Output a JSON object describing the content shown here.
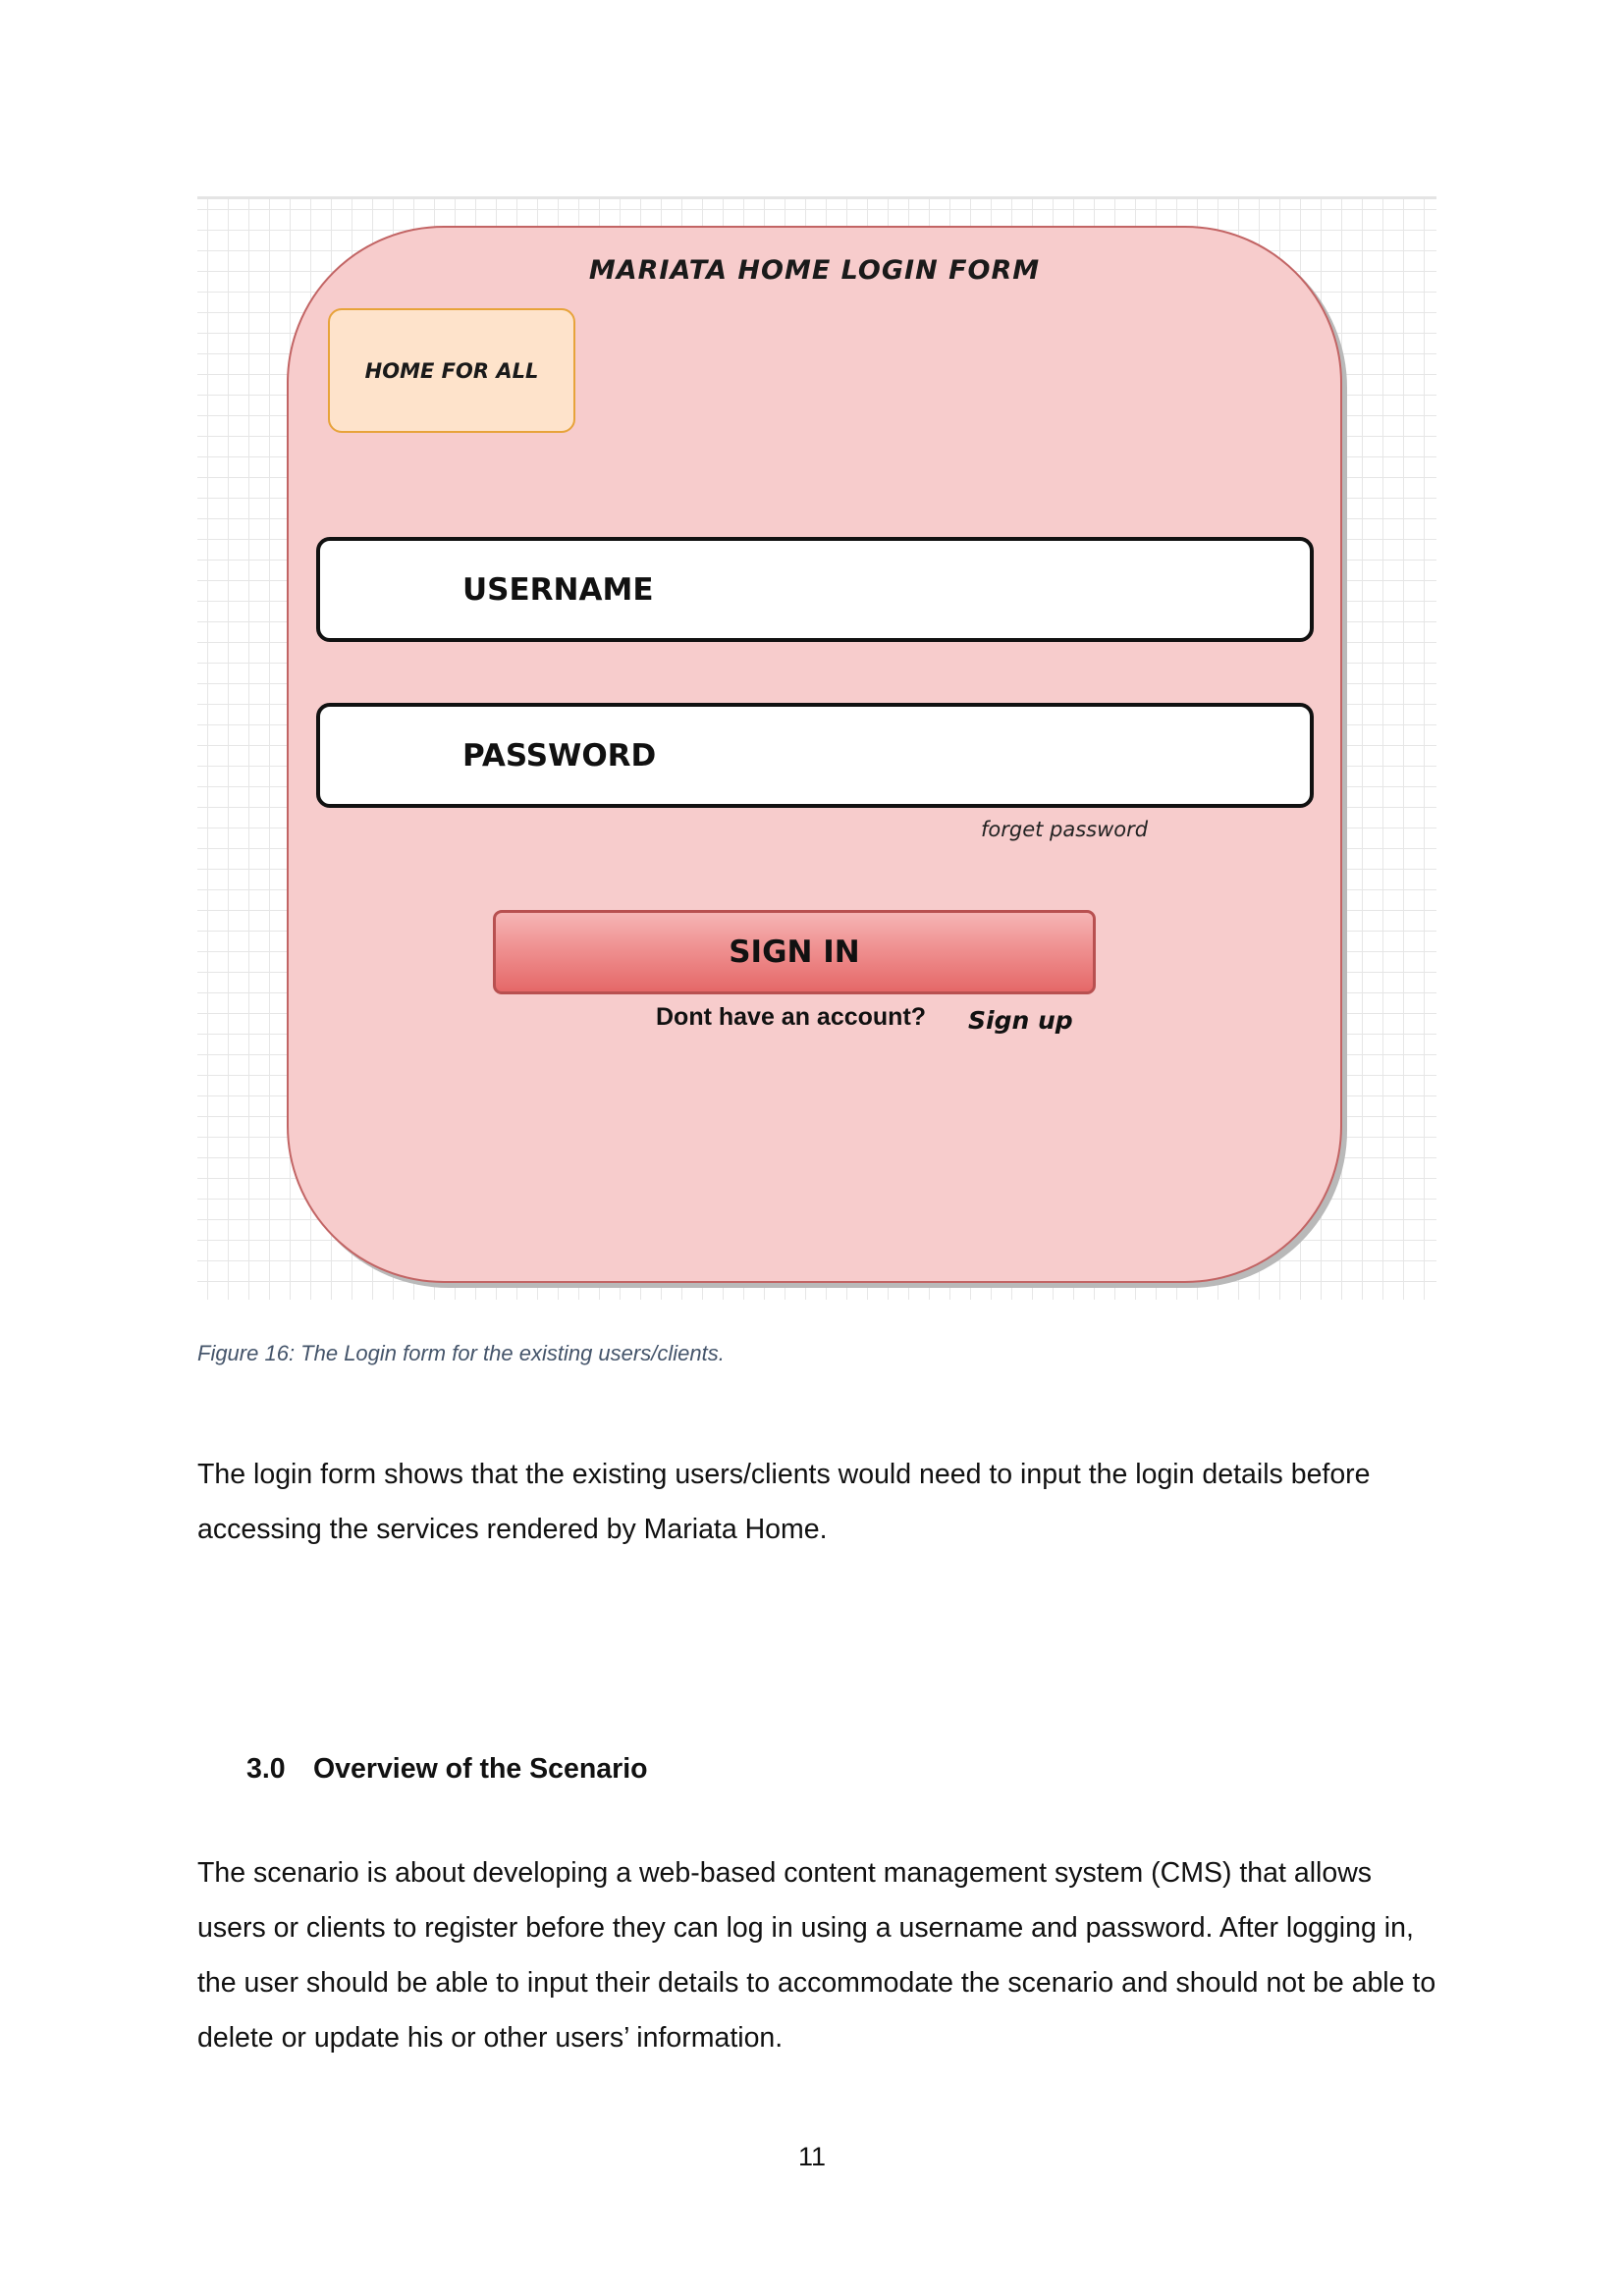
{
  "figure": {
    "form_title": "MARIATA HOME LOGIN FORM",
    "home_box_label": "HOME FOR ALL",
    "username_label": "USERNAME",
    "password_label": "PASSWORD",
    "forget_password": "forget password",
    "signin_label": "SIGN IN",
    "no_account_text": "Dont have an account?",
    "signup_label": "Sign up",
    "colors": {
      "card_fill": "#f7cccc",
      "card_border": "#c26464",
      "home_box_fill": "#fee3cb",
      "home_box_border": "#e7a33a",
      "signin_fill": "#ee8d8d"
    }
  },
  "caption": "Figure 16:  The Login form for the existing users/clients.",
  "paragraph1": "The login form shows that the existing users/clients would need to input the login details before accessing the services rendered by Mariata Home.",
  "section": {
    "number": "3.0",
    "title": "Overview of the Scenario"
  },
  "paragraph2": "The scenario is about developing a web-based content management system (CMS) that allows users or clients to register before they can log in using a username and password.  After logging in, the user should be able to input their details to accommodate the scenario and should not be able to delete or update his or other users’ information.",
  "page_number": "11"
}
